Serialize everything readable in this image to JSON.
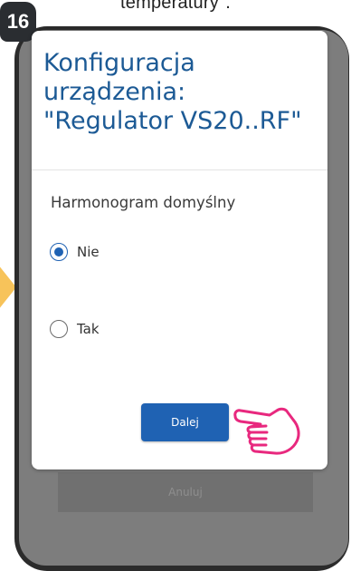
{
  "caption": {
    "text": "temperatury\"."
  },
  "step": {
    "number": "16"
  },
  "background": {
    "cancel_label": "Anuluj"
  },
  "dialog": {
    "title_lines": [
      "Konfiguracja",
      "urządzenia:",
      "\"Regulator VS20..RF\""
    ],
    "section_label": "Harmonogram domyślny",
    "options": [
      {
        "label": "Nie",
        "selected": true
      },
      {
        "label": "Tak",
        "selected": false
      }
    ],
    "next_label": "Dalej"
  },
  "colors": {
    "accent": "#1f62b3",
    "title": "#1c5a95",
    "phone_frame": "#2b2b2b",
    "overlay": "#7d7d7d",
    "arrow": "#f7c35a",
    "hand": "#e8287e"
  },
  "icons": {
    "pointer": "pointing-hand-icon",
    "arrow": "arrow-right-icon"
  }
}
